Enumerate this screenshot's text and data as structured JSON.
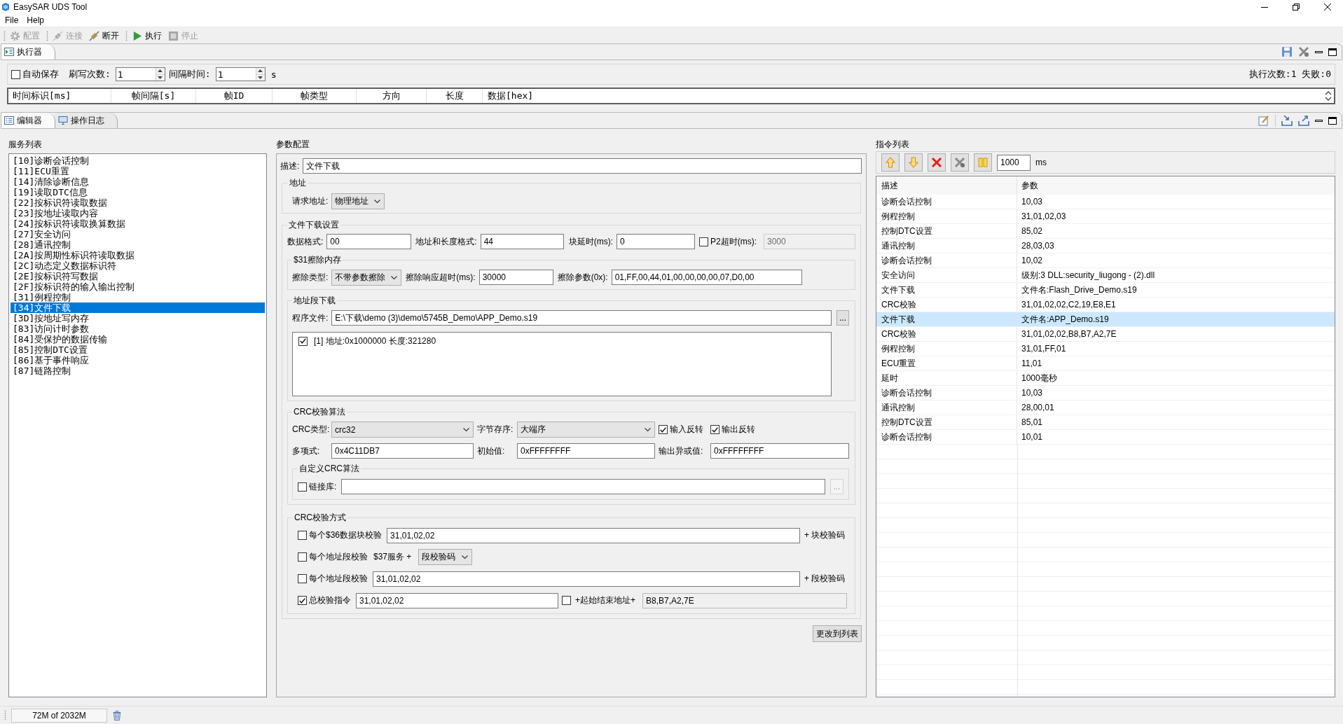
{
  "window": {
    "title": "EasySAR UDS Tool"
  },
  "menu": [
    {
      "label": "File"
    },
    {
      "label": "Help"
    }
  ],
  "toolbar": [
    [
      {
        "label": "配置",
        "disabled": true
      }
    ],
    [
      {
        "label": "连接",
        "disabled": true
      },
      {
        "label": "断开",
        "disabled": false
      }
    ],
    [
      {
        "label": "执行",
        "disabled": false
      },
      {
        "label": "停止",
        "disabled": true
      }
    ]
  ],
  "executor": {
    "tab": "执行器",
    "auto_save": {
      "label": "自动保存",
      "checked": false
    },
    "flash_count": {
      "label": "刷写次数:",
      "value": "1"
    },
    "interval": {
      "label": "间隔时间:",
      "value": "1",
      "unit": "s"
    },
    "stats": "执行次数:1 失败:0",
    "columns": [
      "时间标识[ms]",
      "帧间隔[s]",
      "帧ID",
      "帧类型",
      "方向",
      "长度",
      "数据[hex]"
    ]
  },
  "editor_tabs": [
    {
      "label": "编辑器",
      "selected": true
    },
    {
      "label": "操作日志",
      "selected": false
    }
  ],
  "service_list": {
    "title": "服务列表",
    "items": [
      {
        "label": "[10]诊断会话控制",
        "selected": false
      },
      {
        "label": "[11]ECU重置",
        "selected": false
      },
      {
        "label": "[14]清除诊断信息",
        "selected": false
      },
      {
        "label": "[19]读取DTC信息",
        "selected": false
      },
      {
        "label": "[22]按标识符读取数据",
        "selected": false
      },
      {
        "label": "[23]按地址读取内容",
        "selected": false
      },
      {
        "label": "[24]按标识符读取换算数据",
        "selected": false
      },
      {
        "label": "[27]安全访问",
        "selected": false
      },
      {
        "label": "[28]通讯控制",
        "selected": false
      },
      {
        "label": "[2A]按周期性标识符读取数据",
        "selected": false
      },
      {
        "label": "[2C]动态定义数据标识符",
        "selected": false
      },
      {
        "label": "[2E]按标识符写数据",
        "selected": false
      },
      {
        "label": "[2F]按标识符的输入输出控制",
        "selected": false
      },
      {
        "label": "[31]例程控制",
        "selected": false
      },
      {
        "label": "[34]文件下载",
        "selected": true
      },
      {
        "label": "[3D]按地址写内存",
        "selected": false
      },
      {
        "label": "[83]访问计时参数",
        "selected": false
      },
      {
        "label": "[84]受保护的数据传输",
        "selected": false
      },
      {
        "label": "[85]控制DTC设置",
        "selected": false
      },
      {
        "label": "[86]基于事件响应",
        "selected": false
      },
      {
        "label": "[87]链路控制",
        "selected": false
      }
    ]
  },
  "param_config": {
    "title": "参数配置",
    "description": {
      "label": "描述:",
      "value": "文件下载"
    },
    "address": {
      "title": "地址",
      "request": {
        "label": "请求地址:",
        "value": "物理地址"
      }
    },
    "download": {
      "title": "文件下载设置",
      "data_format": {
        "label": "数据格式:",
        "value": "00"
      },
      "addr_len_format": {
        "label": "地址和长度格式:",
        "value": "44"
      },
      "block_delay": {
        "label": "块延时(ms):",
        "value": "0"
      },
      "p2_timeout": {
        "label": "P2超时(ms):",
        "checked": false,
        "value": "3000"
      },
      "erase": {
        "title": "$31擦除内存",
        "type": {
          "label": "擦除类型:",
          "value": "不带参数擦除"
        },
        "timeout": {
          "label": "擦除响应超时(ms):",
          "value": "30000"
        },
        "params": {
          "label": "擦除参数(0x):",
          "value": "01,FF,00,44,01,00,00,00,00,07,D0,00"
        }
      },
      "segments": {
        "title": "地址段下载",
        "file": {
          "label": "程序文件:",
          "value": "E:\\下载\\demo (3)\\demo\\5745B_Demo\\APP_Demo.s19",
          "browse": "..."
        },
        "items": [
          {
            "label": "[1] 地址:0x1000000 长度:321280",
            "checked": true
          }
        ]
      },
      "crc_algorithm": {
        "title": "CRC校验算法",
        "crc_type": {
          "label": "CRC类型:",
          "value": "crc32"
        },
        "byte_order": {
          "label": "字节存序:",
          "value": "大端序"
        },
        "input_reflect": {
          "label": "输入反转",
          "checked": true
        },
        "output_reflect": {
          "label": "输出反转",
          "checked": true
        },
        "polynomial": {
          "label": "多项式:",
          "value": "0x4C11DB7"
        },
        "initial_value": {
          "label": "初始值:",
          "value": "0xFFFFFFFF"
        },
        "xor_out": {
          "label": "输出异或值:",
          "value": "0xFFFFFFFF"
        },
        "custom": {
          "title": "自定义CRC算法",
          "library": {
            "label": "链接库:",
            "checked": false,
            "browse": "..."
          }
        }
      },
      "crc_method": {
        "title": "CRC校验方式",
        "rows": [
          {
            "kind": "input",
            "label": "每个$36数据块校验",
            "checked": false,
            "value": "31,01,02,02",
            "suffix": "+ 块校验码"
          },
          {
            "kind": "select",
            "label": "每个地址段校验",
            "checked": false,
            "middle": "$37服务 +",
            "value": "段校验码"
          },
          {
            "kind": "input",
            "label": "每个地址段校验",
            "checked": false,
            "value": "31,01,02,02",
            "suffix": "+ 段校验码"
          },
          {
            "kind": "total",
            "label": "总校验指令",
            "checked": true,
            "value": "31,01,02,02",
            "extra": {
              "label": "+起始结束地址+",
              "checked": false,
              "value": "B8,B7,A2,7E"
            }
          }
        ]
      }
    },
    "apply_button": "更改到列表"
  },
  "command_list": {
    "title": "指令列表",
    "delay": {
      "value": "1000",
      "unit": "ms"
    },
    "columns": [
      "描述",
      "参数"
    ],
    "rows": [
      {
        "description": "诊断会话控制",
        "params": "10,03",
        "selected": false
      },
      {
        "description": "例程控制",
        "params": "31,01,02,03",
        "selected": false
      },
      {
        "description": "控制DTC设置",
        "params": "85,02",
        "selected": false
      },
      {
        "description": "通讯控制",
        "params": "28,03,03",
        "selected": false
      },
      {
        "description": "诊断会话控制",
        "params": "10,02",
        "selected": false
      },
      {
        "description": "安全访问",
        "params": "级别:3 DLL:security_liugong - (2).dll",
        "selected": false
      },
      {
        "description": "文件下载",
        "params": "文件名:Flash_Drive_Demo.s19",
        "selected": false
      },
      {
        "description": "CRC校验",
        "params": "31,01,02,02,C2,19,E8,E1",
        "selected": false
      },
      {
        "description": "文件下载",
        "params": "文件名:APP_Demo.s19",
        "selected": true
      },
      {
        "description": "CRC校验",
        "params": "31,01,02,02,B8,B7,A2,7E",
        "selected": false
      },
      {
        "description": "例程控制",
        "params": "31,01,FF,01",
        "selected": false
      },
      {
        "description": "ECU重置",
        "params": "11,01",
        "selected": false
      },
      {
        "description": "延时",
        "params": "1000毫秒",
        "selected": false
      },
      {
        "description": "诊断会话控制",
        "params": "10,03",
        "selected": false
      },
      {
        "description": "通讯控制",
        "params": "28,00,01",
        "selected": false
      },
      {
        "description": "控制DTC设置",
        "params": "85,01",
        "selected": false
      },
      {
        "description": "诊断会话控制",
        "params": "10,01",
        "selected": false
      }
    ]
  },
  "status_bar": {
    "memory": "72M of 2032M"
  }
}
